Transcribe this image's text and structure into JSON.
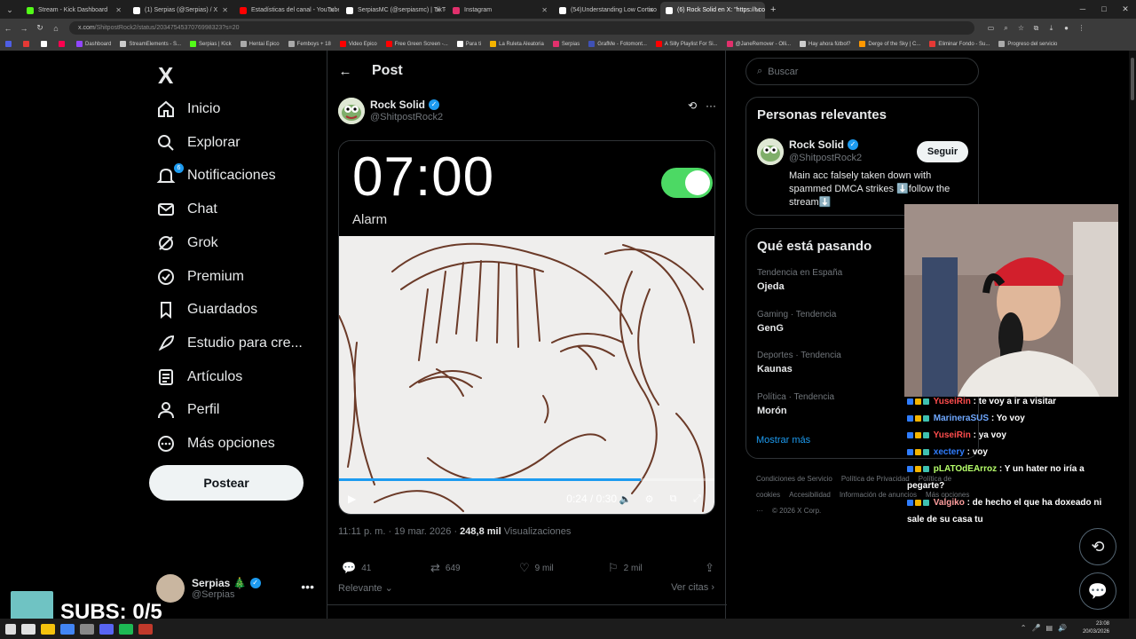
{
  "browser": {
    "tabs": [
      {
        "title": "Stream - Kick Dashboard",
        "color": "#53fc18"
      },
      {
        "title": "(1) Serpias (@Serpias) / X",
        "color": "#ffffff"
      },
      {
        "title": "Estadísticas del canal - YouTube",
        "color": "#ff0000"
      },
      {
        "title": "SerpiasMC (@serpiasmc) | TikTok",
        "color": "#ffffff"
      },
      {
        "title": "Instagram",
        "color": "#e1306c"
      },
      {
        "title": "(54)Understanding Low Cortiso",
        "color": "#ffffff"
      },
      {
        "title": "(6) Rock Solid en X: \"https://t.co",
        "color": "#ffffff"
      }
    ],
    "url_host": "x.com",
    "url_path": "/ShitpostRock2/status/2034754537076998323?s=20",
    "bookmarks": [
      {
        "label": "",
        "color": "#4e5ee4"
      },
      {
        "label": "",
        "color": "#e53935"
      },
      {
        "label": "",
        "color": "#ffffff"
      },
      {
        "label": "",
        "color": "#ff0050"
      },
      {
        "label": "Dashboard",
        "color": "#9146ff"
      },
      {
        "label": "StreamElements - S...",
        "color": "#cccccc"
      },
      {
        "label": "Serpias | Kick",
        "color": "#53fc18"
      },
      {
        "label": "Hentai Epico",
        "color": "#aaaaaa"
      },
      {
        "label": "Femboys + 18",
        "color": "#aaaaaa"
      },
      {
        "label": "Video Epico",
        "color": "#ff0000"
      },
      {
        "label": "Free Green Screen -...",
        "color": "#ff0000"
      },
      {
        "label": "Para ti",
        "color": "#ffffff"
      },
      {
        "label": "La Ruleta Aleatoria",
        "color": "#f4b400"
      },
      {
        "label": "Serpias",
        "color": "#e1306c"
      },
      {
        "label": "GrafMe - Fotomont...",
        "color": "#3f51b5"
      },
      {
        "label": "A Silly Playlist For Si...",
        "color": "#ff0000"
      },
      {
        "label": "@JaneRemover - Olli...",
        "color": "#e1306c"
      },
      {
        "label": "Hay ahora fútbol?",
        "color": "#cccccc"
      },
      {
        "label": "Derge of the Sky | C...",
        "color": "#ff9800"
      },
      {
        "label": "Eliminar Fondo - Su...",
        "color": "#e53935"
      },
      {
        "label": "Progreso del servicio",
        "color": "#aaaaaa"
      }
    ]
  },
  "nav": {
    "logo": "X",
    "items": [
      {
        "label": "Inicio",
        "icon": "home-icon"
      },
      {
        "label": "Explorar",
        "icon": "search-icon"
      },
      {
        "label": "Notificaciones",
        "icon": "bell-icon",
        "badge": "6"
      },
      {
        "label": "Chat",
        "icon": "mail-icon"
      },
      {
        "label": "Grok",
        "icon": "grok-icon"
      },
      {
        "label": "Premium",
        "icon": "verified-icon"
      },
      {
        "label": "Guardados",
        "icon": "bookmark-icon"
      },
      {
        "label": "Estudio para cre...",
        "icon": "rocket-icon"
      },
      {
        "label": "Artículos",
        "icon": "article-icon"
      },
      {
        "label": "Perfil",
        "icon": "person-icon"
      },
      {
        "label": "Más opciones",
        "icon": "more-circle-icon"
      }
    ],
    "post_button": "Postear",
    "account": {
      "name": "Serpias",
      "emoji": "🎄",
      "handle": "@Serpias"
    }
  },
  "post": {
    "header_title": "Post",
    "author_name": "Rock Solid",
    "author_handle": "@ShitpostRock2",
    "video": {
      "alarm_time": "07:00",
      "alarm_label": "Alarm",
      "toggle_color": "#4cd964",
      "current_time": "0:24",
      "duration": "0:30",
      "progress": 0.8
    },
    "timestamp": "11:11 p. m. · 19 mar. 2026",
    "views_count": "248,8 mil",
    "views_label": "Visualizaciones",
    "replies": "41",
    "reposts": "649",
    "likes": "9 mil",
    "bookmarks": "2 mil",
    "sort_label": "Relevante",
    "quotes_label": "Ver citas"
  },
  "sidebar": {
    "search_placeholder": "Buscar",
    "relevant": {
      "title": "Personas relevantes",
      "name": "Rock Solid",
      "handle": "@ShitpostRock2",
      "follow_label": "Seguir",
      "bio": "Main acc falsely taken down with spammed DMCA strikes ⬇️follow the stream⬇️"
    },
    "trends_title": "Qué está pasando",
    "trends": [
      {
        "context": "Tendencia en España",
        "name": "Ojeda"
      },
      {
        "context": "Gaming · Tendencia",
        "name": "GenG"
      },
      {
        "context": "Deportes · Tendencia",
        "name": "Kaunas"
      },
      {
        "context": "Política · Tendencia",
        "name": "Morón"
      }
    ],
    "show_more": "Mostrar más",
    "footer_links": [
      "Condiciones de Servicio",
      "Política de Privacidad",
      "Política de cookies",
      "Accesibilidad",
      "Información de anuncios",
      "Más opciones ···",
      "© 2026 X Corp."
    ]
  },
  "stream": {
    "chat": [
      {
        "user": "YuseiRin",
        "color": "#ff4d4d",
        "text": ": te voy a ir a visitar"
      },
      {
        "user": "MarineraSUS",
        "color": "#6fa8ff",
        "text": ": Yo voy"
      },
      {
        "user": "YuseiRin",
        "color": "#ff4d4d",
        "text": ": ya voy"
      },
      {
        "user": "xectery",
        "color": "#2f7dff",
        "text": ": voy"
      },
      {
        "user": "pLATOdEArroz",
        "color": "#b6ff6b",
        "text": ": Y un hater no iría a pegarte?"
      },
      {
        "user": "Valgiko",
        "color": "#ff9f9f",
        "text": ": de hecho el que ha doxeado ni sale de su casa tu"
      }
    ],
    "subs_text": "SUBS: 0/5"
  },
  "taskbar": {
    "time": "23:08",
    "date": "20/03/2026"
  }
}
